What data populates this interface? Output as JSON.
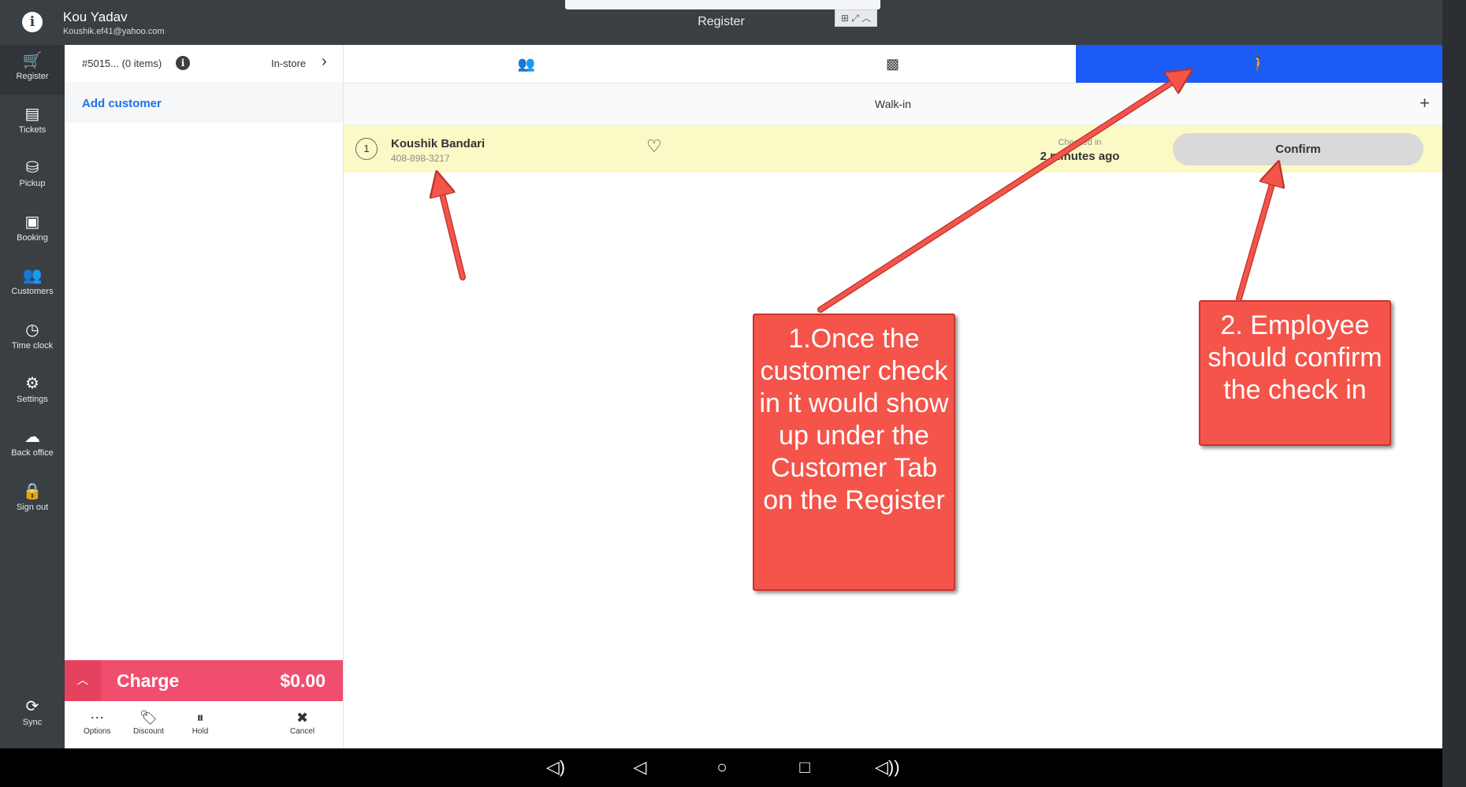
{
  "header": {
    "user_name": "Kou Yadav",
    "user_email": "Koushik.ef41@yahoo.com",
    "title": "Register",
    "info_icon": "i"
  },
  "sidebar": {
    "items": [
      {
        "label": "Register",
        "icon": "cart-icon",
        "glyph": "🛒"
      },
      {
        "label": "Tickets",
        "icon": "list-icon",
        "glyph": "▤"
      },
      {
        "label": "Pickup",
        "icon": "pickup-icon",
        "glyph": "⛁"
      },
      {
        "label": "Booking",
        "icon": "calendar-icon",
        "glyph": "▣"
      },
      {
        "label": "Customers",
        "icon": "people-icon",
        "glyph": "👥"
      },
      {
        "label": "Time clock",
        "icon": "clock-icon",
        "glyph": "◷"
      },
      {
        "label": "Settings",
        "icon": "gear-icon",
        "glyph": "⚙"
      },
      {
        "label": "Back office",
        "icon": "cloud-icon",
        "glyph": "☁"
      },
      {
        "label": "Sign out",
        "icon": "lock-icon",
        "glyph": "🔒"
      }
    ],
    "sync": {
      "label": "Sync",
      "glyph": "⟳"
    }
  },
  "ticket": {
    "id": "#5015... (0 items)",
    "mode": "In-store",
    "add_customer": "Add customer",
    "charge_label": "Charge",
    "charge_amount": "$0.00",
    "actions": [
      {
        "label": "Options",
        "glyph": "⋯"
      },
      {
        "label": "Discount",
        "glyph": "🏷"
      },
      {
        "label": "Hold",
        "glyph": "⏸"
      },
      {
        "label": "Cancel",
        "glyph": "✖"
      }
    ]
  },
  "tabs": [
    {
      "name": "customers",
      "glyph": "👥",
      "active": false
    },
    {
      "name": "gallery",
      "glyph": "▩",
      "active": false
    },
    {
      "name": "walk-in",
      "glyph": "🚶",
      "active": true
    }
  ],
  "walkin": {
    "label": "Walk-in",
    "add_glyph": "+",
    "customer": {
      "number": "1",
      "name": "Koushik Bandari",
      "phone": "408-898-3217",
      "checked_in_label": "Checked in",
      "checked_in_time": "2 minutes ago",
      "confirm_label": "Confirm"
    }
  },
  "android_bar": {
    "buttons": [
      "◁)",
      "◁",
      "○",
      "□",
      "◁))"
    ]
  },
  "callouts": [
    {
      "text": "1.Once the customer check in it would show up under the Customer Tab on the Register"
    },
    {
      "text": "2. Employee should confirm the check in"
    }
  ],
  "colors": {
    "accent_blue": "#1a5cf5",
    "charge_pink": "#f04e6e",
    "highlight_row": "#fbf9c5",
    "callout_red": "#f4544a",
    "dark_chrome": "#3a3f44"
  }
}
